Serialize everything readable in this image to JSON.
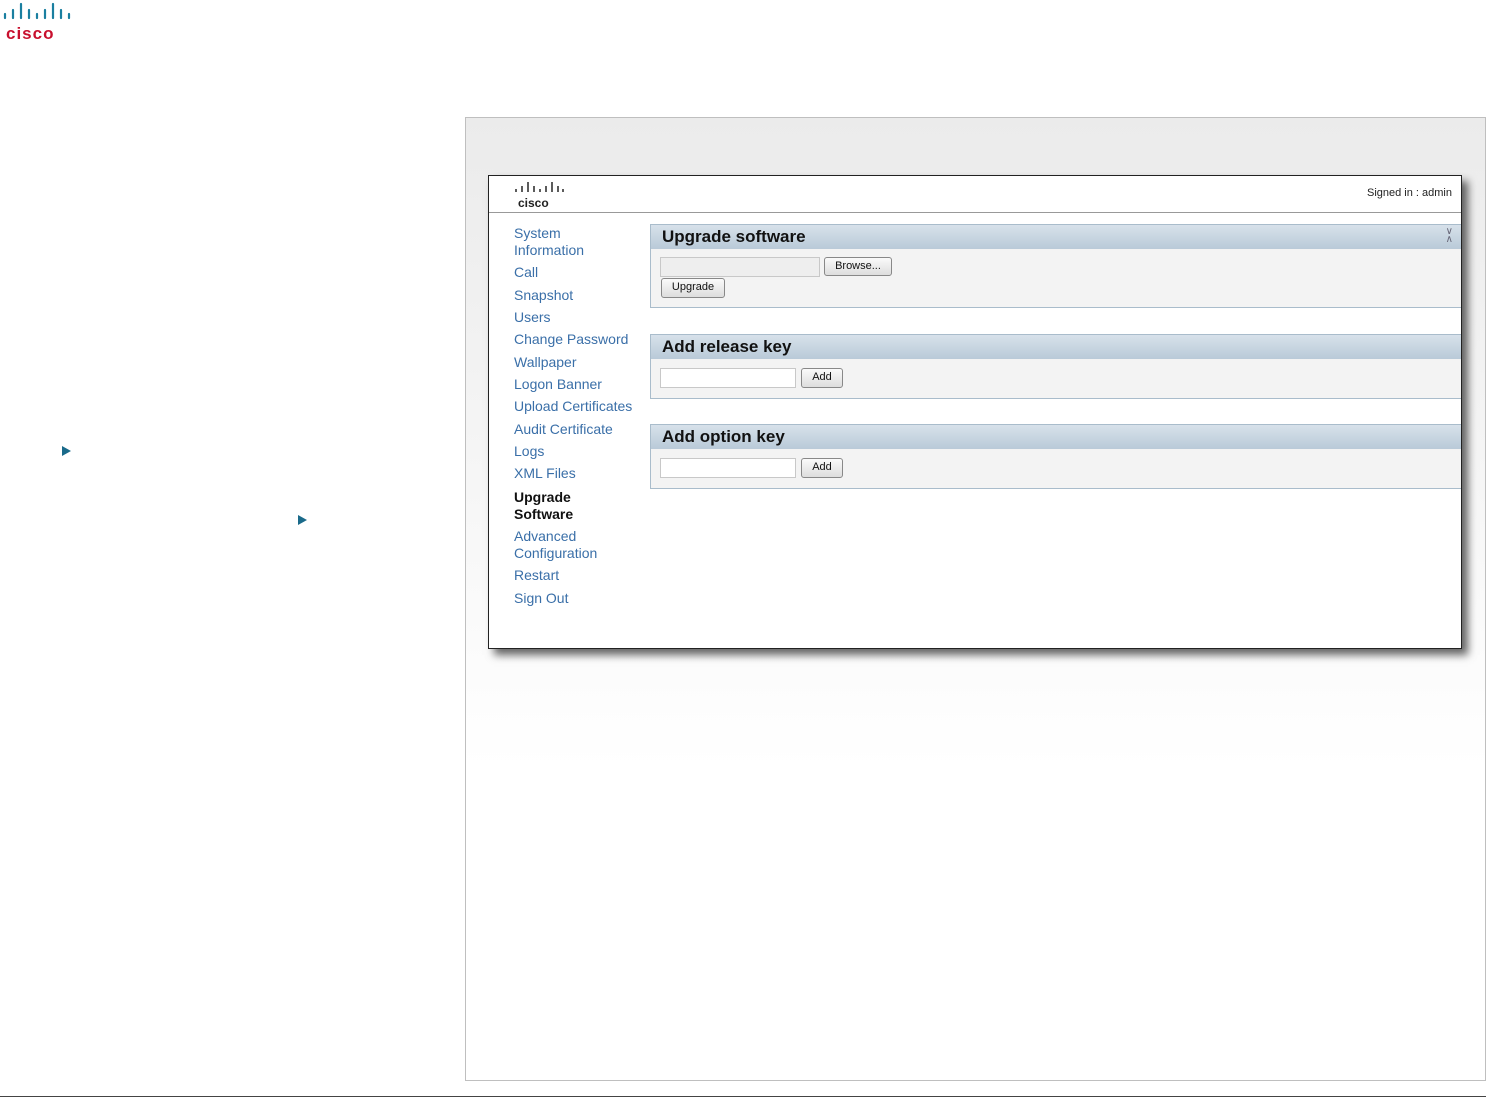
{
  "brand": {
    "logo_text": "CISCO"
  },
  "screenshot": {
    "signed_in": "Signed in : admin",
    "nav": [
      "System Information",
      "Call",
      "Snapshot",
      "Users",
      "Change Password",
      "Wallpaper",
      "Logon Banner",
      "Upload Certificates",
      "Audit Certificate",
      "Logs",
      "XML Files",
      "Upgrade Software",
      "Advanced Configuration",
      "Restart",
      "Sign Out"
    ],
    "active_nav": "Upgrade Software",
    "panels": {
      "upgrade": {
        "title": "Upgrade software",
        "browse": "Browse...",
        "upgrade": "Upgrade"
      },
      "release": {
        "title": "Add release key",
        "add": "Add"
      },
      "option": {
        "title": "Add option key",
        "add": "Add"
      }
    }
  },
  "colors": {
    "accent": "#1a6a8a",
    "link": "#3a6fa8",
    "logo": "#c8102e"
  }
}
